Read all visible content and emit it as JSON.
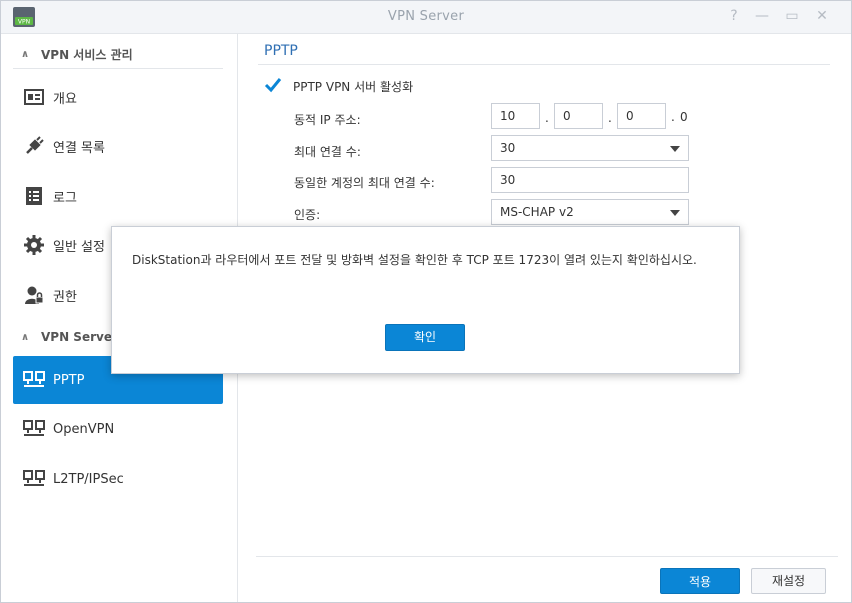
{
  "window": {
    "title": "VPN Server",
    "app_icon_text": "VPN",
    "controls": {
      "help": "?",
      "minimize": "—",
      "maximize": "▭",
      "close": "✕"
    }
  },
  "sidebar": {
    "group1": {
      "label": "VPN 서비스 관리"
    },
    "group1_items": [
      {
        "label": "개요",
        "icon": "overview-card-icon"
      },
      {
        "label": "연결 목록",
        "icon": "plug-icon"
      },
      {
        "label": "로그",
        "icon": "log-list-icon"
      },
      {
        "label": "일반 설정",
        "icon": "gear-icon"
      },
      {
        "label": "권한",
        "icon": "user-lock-icon"
      }
    ],
    "group2": {
      "label": "VPN Server"
    },
    "group2_items": [
      {
        "label": "PPTP",
        "icon": "network-icon",
        "active": true
      },
      {
        "label": "OpenVPN",
        "icon": "network-icon"
      },
      {
        "label": "L2TP/IPSec",
        "icon": "network-icon"
      }
    ]
  },
  "main": {
    "section_title": "PPTP",
    "enable": {
      "label": "PPTP VPN 서버 활성화",
      "checked": true
    },
    "dynamic_ip": {
      "label": "동적 IP 주소:",
      "octet1": "10",
      "octet2": "0",
      "octet3": "0",
      "octet4": "0",
      "separator": "."
    },
    "max_connections": {
      "label": "최대 연결 수:",
      "value": "30"
    },
    "max_same_account": {
      "label": "동일한 계정의 최대 연결 수:",
      "value": "30"
    },
    "auth": {
      "label": "인증:",
      "value": "MS-CHAP v2"
    },
    "buttons": {
      "apply": "적용",
      "reset": "재설정"
    }
  },
  "dialog": {
    "message": "DiskStation과 라우터에서 포트 전달 및 방화벽 설정을 확인한 후 TCP 포트 1723이 열려 있는지 확인하십시오.",
    "ok_label": "확인"
  },
  "colors": {
    "accent": "#0b86d6",
    "section_title": "#2f6fb3"
  }
}
